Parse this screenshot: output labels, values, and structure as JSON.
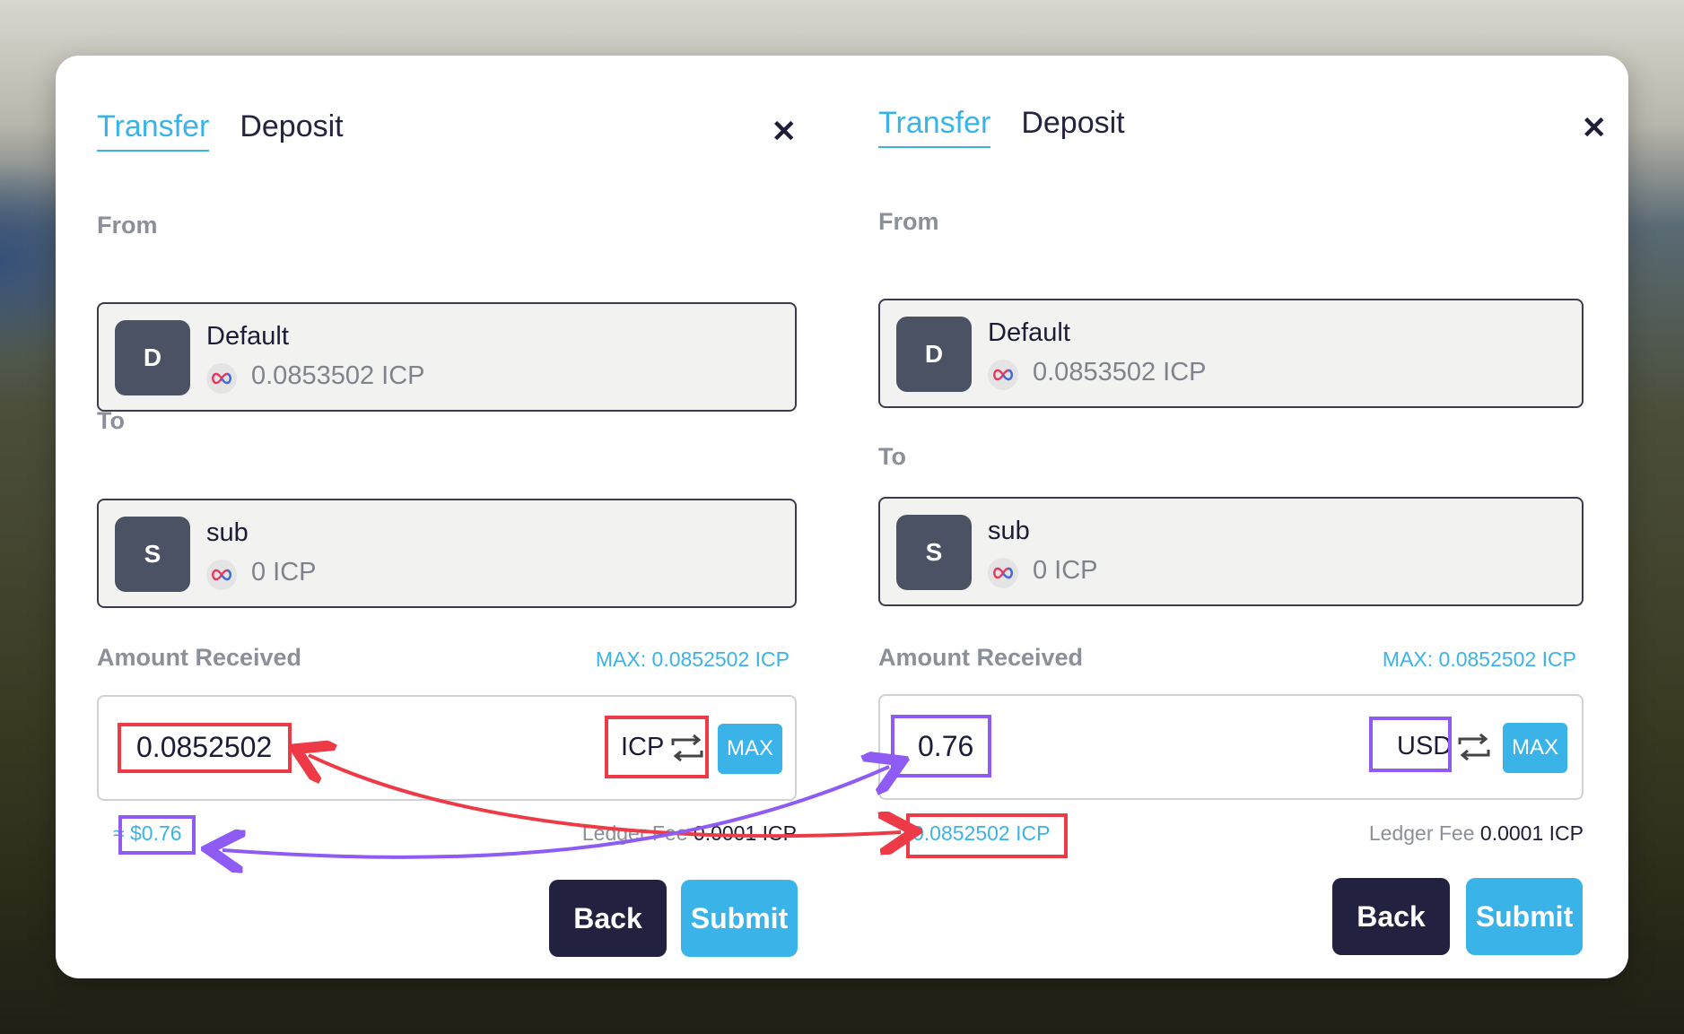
{
  "panels": [
    {
      "tabs": [
        "Transfer",
        "Deposit"
      ],
      "from_label": "From",
      "from": {
        "initial": "D",
        "name": "Default",
        "balance": "0.0853502 ICP"
      },
      "to_label": "To",
      "to": {
        "initial": "S",
        "name": "sub",
        "balance": "0 ICP"
      },
      "amount_label": "Amount Received",
      "max_text": "MAX: 0.0852502 ICP",
      "amount_value": "0.0852502",
      "unit": "ICP",
      "max_button": "MAX",
      "equivalent": "≈ $0.76",
      "fee_label": "Ledger Fee",
      "fee_value": "0.0001 ICP",
      "back": "Back",
      "submit": "Submit"
    },
    {
      "tabs": [
        "Transfer",
        "Deposit"
      ],
      "from_label": "From",
      "from": {
        "initial": "D",
        "name": "Default",
        "balance": "0.0853502 ICP"
      },
      "to_label": "To",
      "to": {
        "initial": "S",
        "name": "sub",
        "balance": "0 ICP"
      },
      "amount_label": "Amount Received",
      "max_text": "MAX: 0.0852502 ICP",
      "amount_value": "0.76",
      "unit": "USD",
      "max_button": "MAX",
      "equivalent": "0.0852502 ICP",
      "fee_label": "Ledger Fee",
      "fee_value": "0.0001 ICP",
      "back": "Back",
      "submit": "Submit"
    }
  ],
  "colors": {
    "accent": "#3ab3e8",
    "highlight_red": "#ee3a46",
    "highlight_purple": "#8e5cf5",
    "dark": "#22213f"
  }
}
